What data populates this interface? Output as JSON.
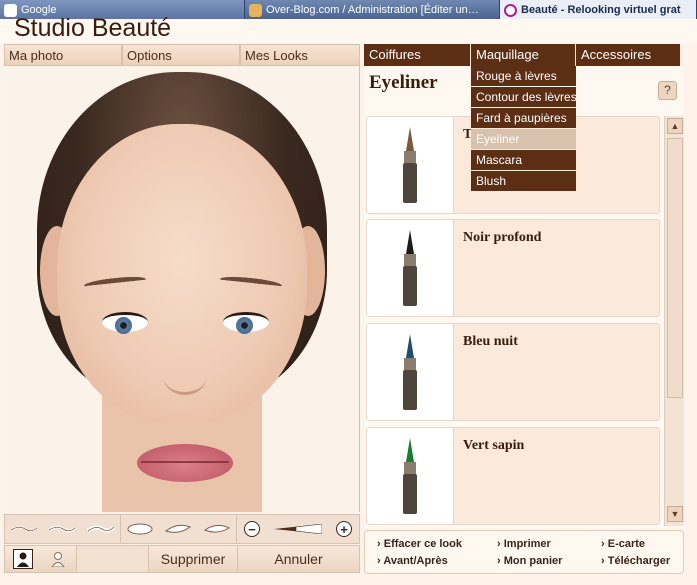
{
  "taskbar": {
    "tasks": [
      "Google",
      "Over-Blog.com / Administration [Éditer un…",
      "Beauté - Relooking virtuel grat"
    ]
  },
  "app": {
    "title": "Studio Beauté"
  },
  "left_tabs": [
    "Ma photo",
    "Options",
    "Mes Looks"
  ],
  "actions": {
    "delete": "Supprimer",
    "cancel": "Annuler"
  },
  "right_tabs": [
    "Coiffures",
    "Maquillage",
    "Accessoires"
  ],
  "panel": {
    "title": "Eyeliner",
    "help": "?",
    "items": [
      {
        "name": "T",
        "tip_color": "#7b5a3c"
      },
      {
        "name": "Noir profond",
        "tip_color": "#1f1a18"
      },
      {
        "name": "Bleu nuit",
        "tip_color": "#1f4f6a"
      },
      {
        "name": "Vert sapin",
        "tip_color": "#1e7a2e"
      }
    ]
  },
  "dropdown": {
    "items": [
      "Rouge à lèvres",
      "Contour des lèvres",
      "Fard à paupières",
      "Eyeliner",
      "Mascara",
      "Blush"
    ],
    "highlighted": "Eyeliner"
  },
  "footer": {
    "links": [
      "Effacer ce look",
      "Imprimer",
      "E-carte",
      "Avant/Après",
      "Mon panier",
      "Télécharger"
    ]
  },
  "icons": {
    "zoom_out": "−",
    "zoom_in": "+"
  },
  "colors": {
    "brown": "#5c2e14",
    "panel_bg": "#fff8f1",
    "highlight": "#d8c1ad"
  }
}
